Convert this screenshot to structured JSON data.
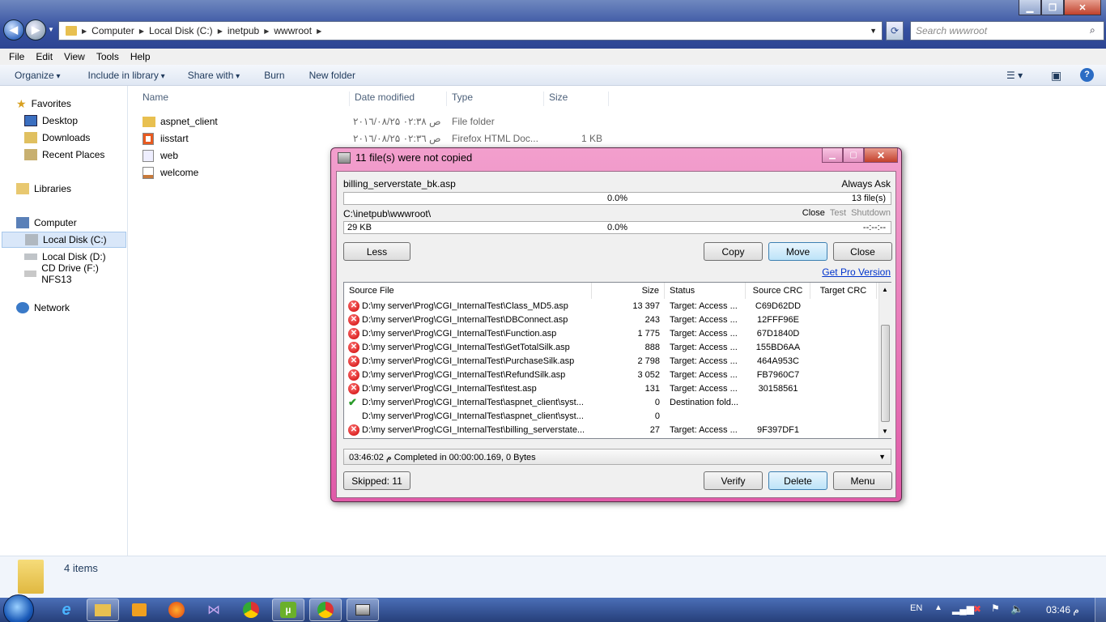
{
  "explorer": {
    "address": [
      "Computer",
      "Local Disk (C:)",
      "inetpub",
      "wwwroot"
    ],
    "search_placeholder": "Search wwwroot",
    "menu": [
      "File",
      "Edit",
      "View",
      "Tools",
      "Help"
    ],
    "commands": [
      "Organize",
      "Include in library",
      "Share with",
      "Burn",
      "New folder"
    ],
    "nav": {
      "favorites": "Favorites",
      "fav_items": [
        "Desktop",
        "Downloads",
        "Recent Places"
      ],
      "libraries": "Libraries",
      "computer": "Computer",
      "drives": [
        "Local Disk (C:)",
        "Local Disk (D:)",
        "CD Drive (F:) NFS13"
      ],
      "network": "Network"
    },
    "columns": [
      "Name",
      "Date modified",
      "Type",
      "Size"
    ],
    "files": [
      {
        "name": "aspnet_client",
        "date": "۲۰۱٦/۰۸/۲۵ ص ۰۲:۳۸",
        "type": "File folder",
        "size": ""
      },
      {
        "name": "iisstart",
        "date": "۲۰۱٦/۰۸/۲۵ ص ۰۲:۳٦",
        "type": "Firefox HTML Doc...",
        "size": "1 KB"
      },
      {
        "name": "web",
        "date": "",
        "type": "",
        "size": ""
      },
      {
        "name": "welcome",
        "date": "",
        "type": "",
        "size": ""
      }
    ],
    "item_count": "4 items"
  },
  "dialog": {
    "title": "11 file(s) were not copied",
    "current_file": "billing_serverstate_bk.asp",
    "always_ask": "Always Ask",
    "progress1_pct": "0.0%",
    "progress1_right": "13 file(s)",
    "dest_path": "C:\\inetpub\\wwwroot\\",
    "after_options": [
      "Close",
      "Test",
      "Shutdown"
    ],
    "progress2_left": "29 KB",
    "progress2_pct": "0.0%",
    "progress2_right": "--:--:--",
    "buttons": {
      "less": "Less",
      "copy": "Copy",
      "move": "Move",
      "close": "Close",
      "verify": "Verify",
      "delete": "Delete",
      "menu": "Menu"
    },
    "pro_link": "Get Pro Version",
    "grid_columns": [
      "Source File",
      "Size",
      "Status",
      "Source CRC",
      "Target CRC"
    ],
    "rows": [
      {
        "icon": "error",
        "file": "D:\\my server\\Prog\\CGI_InternalTest\\Class_MD5.asp",
        "size": "13 397",
        "status": "Target: Access ...",
        "src_crc": "C69D62DD",
        "tgt_crc": ""
      },
      {
        "icon": "error",
        "file": "D:\\my server\\Prog\\CGI_InternalTest\\DBConnect.asp",
        "size": "243",
        "status": "Target: Access ...",
        "src_crc": "12FFF96E",
        "tgt_crc": ""
      },
      {
        "icon": "error",
        "file": "D:\\my server\\Prog\\CGI_InternalTest\\Function.asp",
        "size": "1 775",
        "status": "Target: Access ...",
        "src_crc": "67D1840D",
        "tgt_crc": ""
      },
      {
        "icon": "error",
        "file": "D:\\my server\\Prog\\CGI_InternalTest\\GetTotalSilk.asp",
        "size": "888",
        "status": "Target: Access ...",
        "src_crc": "155BD6AA",
        "tgt_crc": ""
      },
      {
        "icon": "error",
        "file": "D:\\my server\\Prog\\CGI_InternalTest\\PurchaseSilk.asp",
        "size": "2 798",
        "status": "Target: Access ...",
        "src_crc": "464A953C",
        "tgt_crc": ""
      },
      {
        "icon": "error",
        "file": "D:\\my server\\Prog\\CGI_InternalTest\\RefundSilk.asp",
        "size": "3 052",
        "status": "Target: Access ...",
        "src_crc": "FB7960C7",
        "tgt_crc": ""
      },
      {
        "icon": "error",
        "file": "D:\\my server\\Prog\\CGI_InternalTest\\test.asp",
        "size": "131",
        "status": "Target: Access ...",
        "src_crc": "30158561",
        "tgt_crc": ""
      },
      {
        "icon": "ok",
        "file": "D:\\my server\\Prog\\CGI_InternalTest\\aspnet_client\\syst...",
        "size": "0",
        "status": "Destination fold...",
        "src_crc": "",
        "tgt_crc": ""
      },
      {
        "icon": "none",
        "file": "D:\\my server\\Prog\\CGI_InternalTest\\aspnet_client\\syst...",
        "size": "0",
        "status": "",
        "src_crc": "",
        "tgt_crc": ""
      },
      {
        "icon": "error",
        "file": "D:\\my server\\Prog\\CGI_InternalTest\\billing_serverstate...",
        "size": "27",
        "status": "Target: Access ...",
        "src_crc": "9F397DF1",
        "tgt_crc": ""
      }
    ],
    "log_line": "03:46:02 م Completed in 00:00:00.169, 0 Bytes",
    "skipped": "Skipped: 11"
  },
  "taskbar": {
    "lang": "EN",
    "clock": "03:46 م"
  },
  "colors": {
    "dialog_frame": "#e86bb5",
    "titlebar": "#3550a0",
    "taskbar": "#2f4d90"
  }
}
